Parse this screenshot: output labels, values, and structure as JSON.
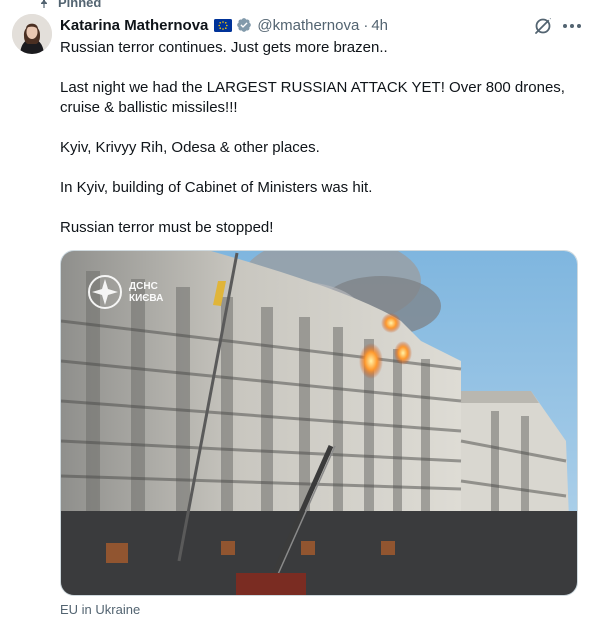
{
  "post": {
    "pinned_label": "Pinned",
    "author_name": "Katarina Mathernova",
    "handle": "@kmathernova",
    "separator": "·",
    "time": "4h",
    "paragraphs": [
      "Russian terror continues. Just gets more brazen..",
      "Last night we had the LARGEST RUSSIAN ATTACK YET! Over 800 drones, cruise & ballistic missiles!!!",
      "Kyiv, Krivyy Rih, Odesa & other places.",
      "In Kyiv, building of Cabinet of Ministers was hit.",
      "Russian terror must be stopped!"
    ],
    "media": {
      "watermark_line1": "ДСНС",
      "watermark_line2": "КИЄВА"
    },
    "source_label": "EU in Ukraine"
  },
  "icons": {
    "pin": "pin-icon",
    "flag": "eu-flag-icon",
    "verified": "verified-badge-icon",
    "grok": "grok-icon",
    "more": "more-icon"
  },
  "colors": {
    "text": "#0f1419",
    "secondary": "#536471",
    "verified_gray": "#829aab",
    "eu_blue": "#003399",
    "eu_gold": "#ffcc00"
  }
}
